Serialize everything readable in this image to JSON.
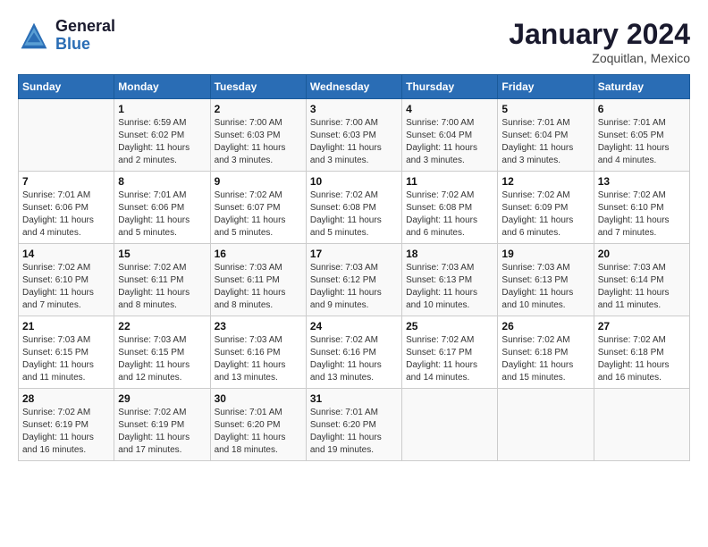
{
  "logo": {
    "line1": "General",
    "line2": "Blue"
  },
  "title": "January 2024",
  "subtitle": "Zoquitlan, Mexico",
  "days_header": [
    "Sunday",
    "Monday",
    "Tuesday",
    "Wednesday",
    "Thursday",
    "Friday",
    "Saturday"
  ],
  "weeks": [
    [
      {
        "day": "",
        "info": ""
      },
      {
        "day": "1",
        "info": "Sunrise: 6:59 AM\nSunset: 6:02 PM\nDaylight: 11 hours\nand 2 minutes."
      },
      {
        "day": "2",
        "info": "Sunrise: 7:00 AM\nSunset: 6:03 PM\nDaylight: 11 hours\nand 3 minutes."
      },
      {
        "day": "3",
        "info": "Sunrise: 7:00 AM\nSunset: 6:03 PM\nDaylight: 11 hours\nand 3 minutes."
      },
      {
        "day": "4",
        "info": "Sunrise: 7:00 AM\nSunset: 6:04 PM\nDaylight: 11 hours\nand 3 minutes."
      },
      {
        "day": "5",
        "info": "Sunrise: 7:01 AM\nSunset: 6:04 PM\nDaylight: 11 hours\nand 3 minutes."
      },
      {
        "day": "6",
        "info": "Sunrise: 7:01 AM\nSunset: 6:05 PM\nDaylight: 11 hours\nand 4 minutes."
      }
    ],
    [
      {
        "day": "7",
        "info": "Sunrise: 7:01 AM\nSunset: 6:06 PM\nDaylight: 11 hours\nand 4 minutes."
      },
      {
        "day": "8",
        "info": "Sunrise: 7:01 AM\nSunset: 6:06 PM\nDaylight: 11 hours\nand 5 minutes."
      },
      {
        "day": "9",
        "info": "Sunrise: 7:02 AM\nSunset: 6:07 PM\nDaylight: 11 hours\nand 5 minutes."
      },
      {
        "day": "10",
        "info": "Sunrise: 7:02 AM\nSunset: 6:08 PM\nDaylight: 11 hours\nand 5 minutes."
      },
      {
        "day": "11",
        "info": "Sunrise: 7:02 AM\nSunset: 6:08 PM\nDaylight: 11 hours\nand 6 minutes."
      },
      {
        "day": "12",
        "info": "Sunrise: 7:02 AM\nSunset: 6:09 PM\nDaylight: 11 hours\nand 6 minutes."
      },
      {
        "day": "13",
        "info": "Sunrise: 7:02 AM\nSunset: 6:10 PM\nDaylight: 11 hours\nand 7 minutes."
      }
    ],
    [
      {
        "day": "14",
        "info": "Sunrise: 7:02 AM\nSunset: 6:10 PM\nDaylight: 11 hours\nand 7 minutes."
      },
      {
        "day": "15",
        "info": "Sunrise: 7:02 AM\nSunset: 6:11 PM\nDaylight: 11 hours\nand 8 minutes."
      },
      {
        "day": "16",
        "info": "Sunrise: 7:03 AM\nSunset: 6:11 PM\nDaylight: 11 hours\nand 8 minutes."
      },
      {
        "day": "17",
        "info": "Sunrise: 7:03 AM\nSunset: 6:12 PM\nDaylight: 11 hours\nand 9 minutes."
      },
      {
        "day": "18",
        "info": "Sunrise: 7:03 AM\nSunset: 6:13 PM\nDaylight: 11 hours\nand 10 minutes."
      },
      {
        "day": "19",
        "info": "Sunrise: 7:03 AM\nSunset: 6:13 PM\nDaylight: 11 hours\nand 10 minutes."
      },
      {
        "day": "20",
        "info": "Sunrise: 7:03 AM\nSunset: 6:14 PM\nDaylight: 11 hours\nand 11 minutes."
      }
    ],
    [
      {
        "day": "21",
        "info": "Sunrise: 7:03 AM\nSunset: 6:15 PM\nDaylight: 11 hours\nand 11 minutes."
      },
      {
        "day": "22",
        "info": "Sunrise: 7:03 AM\nSunset: 6:15 PM\nDaylight: 11 hours\nand 12 minutes."
      },
      {
        "day": "23",
        "info": "Sunrise: 7:03 AM\nSunset: 6:16 PM\nDaylight: 11 hours\nand 13 minutes."
      },
      {
        "day": "24",
        "info": "Sunrise: 7:02 AM\nSunset: 6:16 PM\nDaylight: 11 hours\nand 13 minutes."
      },
      {
        "day": "25",
        "info": "Sunrise: 7:02 AM\nSunset: 6:17 PM\nDaylight: 11 hours\nand 14 minutes."
      },
      {
        "day": "26",
        "info": "Sunrise: 7:02 AM\nSunset: 6:18 PM\nDaylight: 11 hours\nand 15 minutes."
      },
      {
        "day": "27",
        "info": "Sunrise: 7:02 AM\nSunset: 6:18 PM\nDaylight: 11 hours\nand 16 minutes."
      }
    ],
    [
      {
        "day": "28",
        "info": "Sunrise: 7:02 AM\nSunset: 6:19 PM\nDaylight: 11 hours\nand 16 minutes."
      },
      {
        "day": "29",
        "info": "Sunrise: 7:02 AM\nSunset: 6:19 PM\nDaylight: 11 hours\nand 17 minutes."
      },
      {
        "day": "30",
        "info": "Sunrise: 7:01 AM\nSunset: 6:20 PM\nDaylight: 11 hours\nand 18 minutes."
      },
      {
        "day": "31",
        "info": "Sunrise: 7:01 AM\nSunset: 6:20 PM\nDaylight: 11 hours\nand 19 minutes."
      },
      {
        "day": "",
        "info": ""
      },
      {
        "day": "",
        "info": ""
      },
      {
        "day": "",
        "info": ""
      }
    ]
  ]
}
